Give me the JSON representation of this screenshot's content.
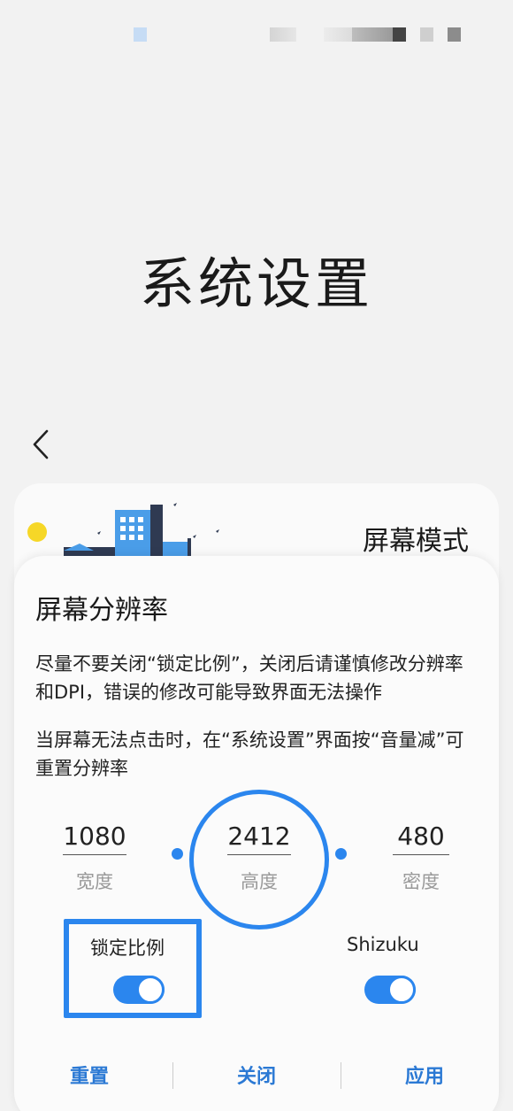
{
  "page": {
    "title": "系统设置"
  },
  "mode_card": {
    "title": "屏幕模式"
  },
  "dialog": {
    "title": "屏幕分辨率",
    "desc_1": "尽量不要关闭“锁定比例”，关闭后请谨慎修改分辨率和DPI，错误的修改可能导致界面无法操作",
    "desc_2": "当屏幕无法点击时，在“系统设置”界面按“音量减”可重置分辨率",
    "fields": {
      "width": {
        "value": "1080",
        "label": "宽度"
      },
      "height": {
        "value": "2412",
        "label": "高度"
      },
      "density": {
        "value": "480",
        "label": "密度"
      }
    },
    "options": {
      "lock_ratio": {
        "label": "锁定比例",
        "enabled": true
      },
      "shizuku": {
        "label": "Shizuku",
        "enabled": true
      }
    },
    "actions": {
      "reset": "重置",
      "close": "关闭",
      "apply": "应用"
    }
  },
  "colors": {
    "accent": "#2b86ee",
    "sun": "#f6d727",
    "building": "#4a9de8"
  }
}
